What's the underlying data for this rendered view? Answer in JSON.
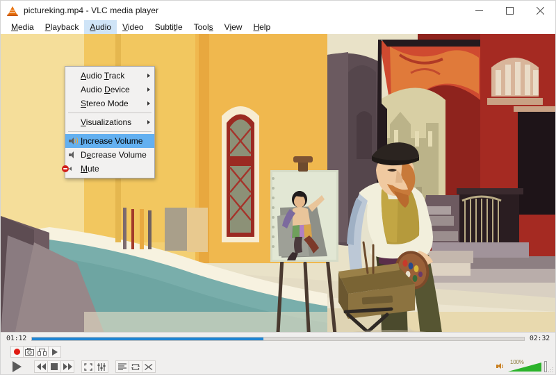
{
  "window": {
    "title": "pictureking.mp4 - VLC media player",
    "app_icon": "vlc-cone-icon",
    "controls": {
      "minimize": "minimize-icon",
      "maximize": "maximize-icon",
      "close": "close-icon"
    }
  },
  "menubar": {
    "items": [
      {
        "label": "Media",
        "mnemonic": "M",
        "active": false
      },
      {
        "label": "Playback",
        "mnemonic": "P",
        "active": false
      },
      {
        "label": "Audio",
        "mnemonic": "A",
        "active": true
      },
      {
        "label": "Video",
        "mnemonic": "V",
        "active": false
      },
      {
        "label": "Subtitle",
        "mnemonic": "t",
        "active": false
      },
      {
        "label": "Tools",
        "mnemonic": "s",
        "active": false
      },
      {
        "label": "View",
        "mnemonic": "i",
        "active": false
      },
      {
        "label": "Help",
        "mnemonic": "H",
        "active": false
      }
    ]
  },
  "audio_menu": {
    "open": true,
    "highlight_color": "#63b0f0",
    "entries": [
      {
        "type": "item",
        "label": "Audio Track",
        "mnemonic": "T",
        "submenu": true,
        "icon": null,
        "selected": false
      },
      {
        "type": "item",
        "label": "Audio Device",
        "mnemonic": "D",
        "submenu": true,
        "icon": null,
        "selected": false
      },
      {
        "type": "item",
        "label": "Stereo Mode",
        "mnemonic": "S",
        "submenu": true,
        "icon": null,
        "selected": false
      },
      {
        "type": "separator"
      },
      {
        "type": "item",
        "label": "Visualizations",
        "mnemonic": "V",
        "submenu": true,
        "icon": null,
        "selected": false
      },
      {
        "type": "separator"
      },
      {
        "type": "item",
        "label": "Increase Volume",
        "mnemonic": "I",
        "submenu": false,
        "icon": "speaker-up-icon",
        "selected": true
      },
      {
        "type": "item",
        "label": "Decrease Volume",
        "mnemonic": "e",
        "submenu": false,
        "icon": "speaker-down-icon",
        "selected": false
      },
      {
        "type": "item",
        "label": "Mute",
        "mnemonic": "M",
        "submenu": false,
        "icon": "mute-icon",
        "selected": false
      }
    ]
  },
  "video": {
    "scene_description": "Painterly illustration of a street artist in a beret painting at an easel in a sunlit Mediterranean alley",
    "palette": {
      "wall_yellow": "#f0b84e",
      "wall_cream": "#f3e2a8",
      "teal_wall": "#79aeab",
      "red_building": "#a52a22",
      "dark_red": "#7d1f1c",
      "stone_gray": "#9b8e8e",
      "shadow_purple": "#6d5a60",
      "olive": "#5d5c36",
      "mustard": "#b59a3c",
      "sky_cream": "#e9e2c8"
    }
  },
  "playback": {
    "elapsed": "01:12",
    "total": "02:32",
    "progress_percent": 47,
    "seek_fill_color": "#1e85d4",
    "buttons_row_extra": [
      {
        "name": "record-button",
        "icon": "record-icon"
      },
      {
        "name": "snapshot-button",
        "icon": "camera-icon"
      },
      {
        "name": "ab-loop-button",
        "icon": "ab-loop-icon"
      },
      {
        "name": "frame-by-frame-button",
        "icon": "frame-step-icon"
      }
    ],
    "buttons_row_main": [
      {
        "name": "play-button",
        "icon": "play-icon"
      },
      {
        "name": "previous-button",
        "icon": "previous-icon"
      },
      {
        "name": "stop-button",
        "icon": "stop-icon"
      },
      {
        "name": "next-button",
        "icon": "next-icon"
      },
      {
        "name": "fullscreen-button",
        "icon": "fullscreen-icon"
      },
      {
        "name": "equalizer-button",
        "icon": "equalizer-icon"
      },
      {
        "name": "playlist-button",
        "icon": "playlist-icon"
      },
      {
        "name": "loop-button",
        "icon": "loop-icon"
      },
      {
        "name": "shuffle-button",
        "icon": "shuffle-icon"
      }
    ],
    "volume": {
      "label": "100%",
      "level_percent": 100,
      "icon": "speaker-icon",
      "fill_color": "#2bb32b"
    }
  }
}
